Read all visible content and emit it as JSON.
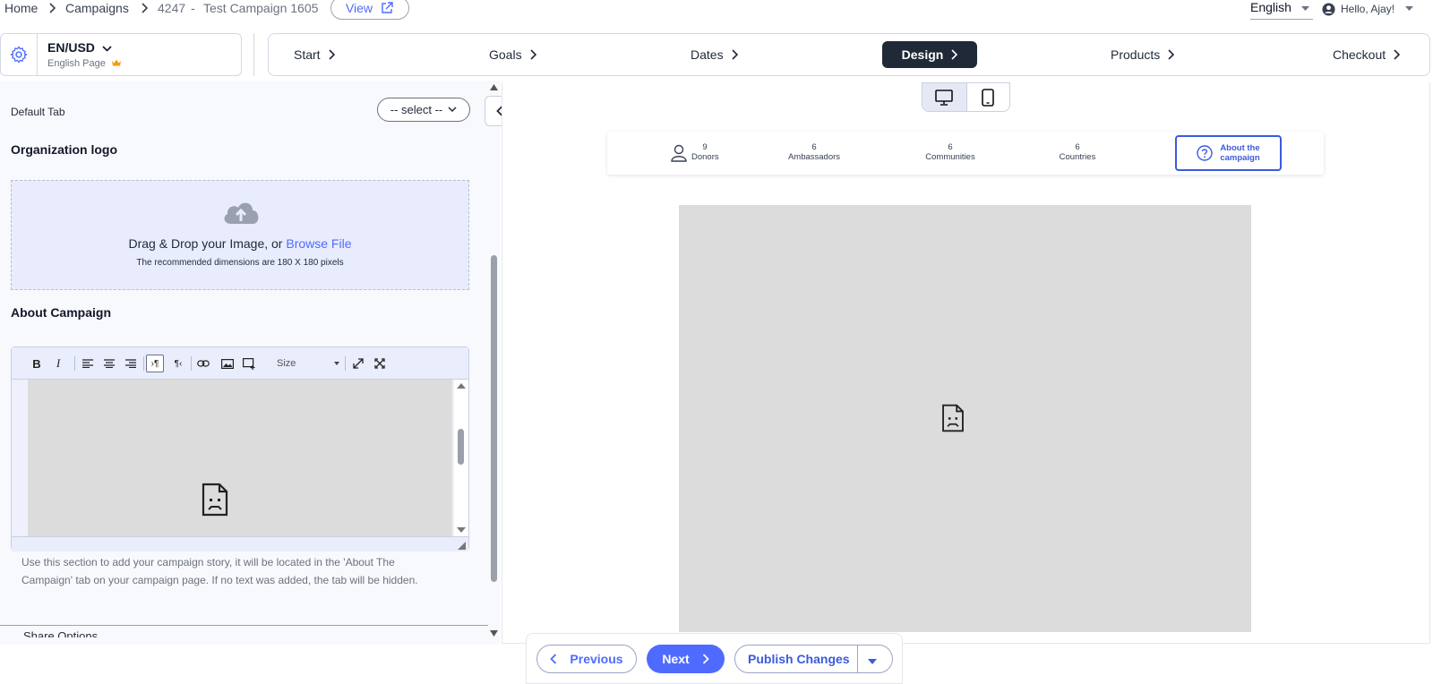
{
  "breadcrumb": {
    "home": "Home",
    "campaigns": "Campaigns",
    "campaign_id": "4247",
    "separator": "-",
    "campaign_name": "Test Campaign 1605"
  },
  "view_button": {
    "label": "View"
  },
  "header_right": {
    "language": "English",
    "greeting": "Hello, Ajay!"
  },
  "locale": {
    "code": "EN/USD",
    "page_label": "English Page"
  },
  "steps": [
    {
      "label": "Start",
      "active": false
    },
    {
      "label": "Goals",
      "active": false
    },
    {
      "label": "Dates",
      "active": false
    },
    {
      "label": "Design",
      "active": true
    },
    {
      "label": "Products",
      "active": false
    },
    {
      "label": "Checkout",
      "active": false
    }
  ],
  "panel": {
    "default_tab_label": "Default Tab",
    "select_placeholder": "-- select --",
    "org_logo_heading": "Organization logo",
    "drop_text": "Drag & Drop your Image, or ",
    "browse_link": "Browse File",
    "drop_hint": "The recommended dimensions are 180 X 180 pixels",
    "about_heading": "About Campaign",
    "size_label": "Size",
    "helper_text": "Use this section to add your campaign story, it will be located in the 'About The Campaign' tab on your campaign page. If no text was added, the tab will be hidden.",
    "next_section": "Share Options"
  },
  "stats": [
    {
      "value": "9",
      "label": "Donors"
    },
    {
      "value": "6",
      "label": "Ambassadors"
    },
    {
      "value": "6",
      "label": "Communities"
    },
    {
      "value": "6",
      "label": "Countries"
    }
  ],
  "about_tab": {
    "line1": "About the",
    "line2": "campaign"
  },
  "nav": {
    "previous": "Previous",
    "next": "Next",
    "publish": "Publish Changes"
  },
  "colors": {
    "accent": "#4f6bff",
    "active_step": "#1f2937",
    "dropzone_bg": "#e8ecfd",
    "crown": "#f59e0b"
  }
}
